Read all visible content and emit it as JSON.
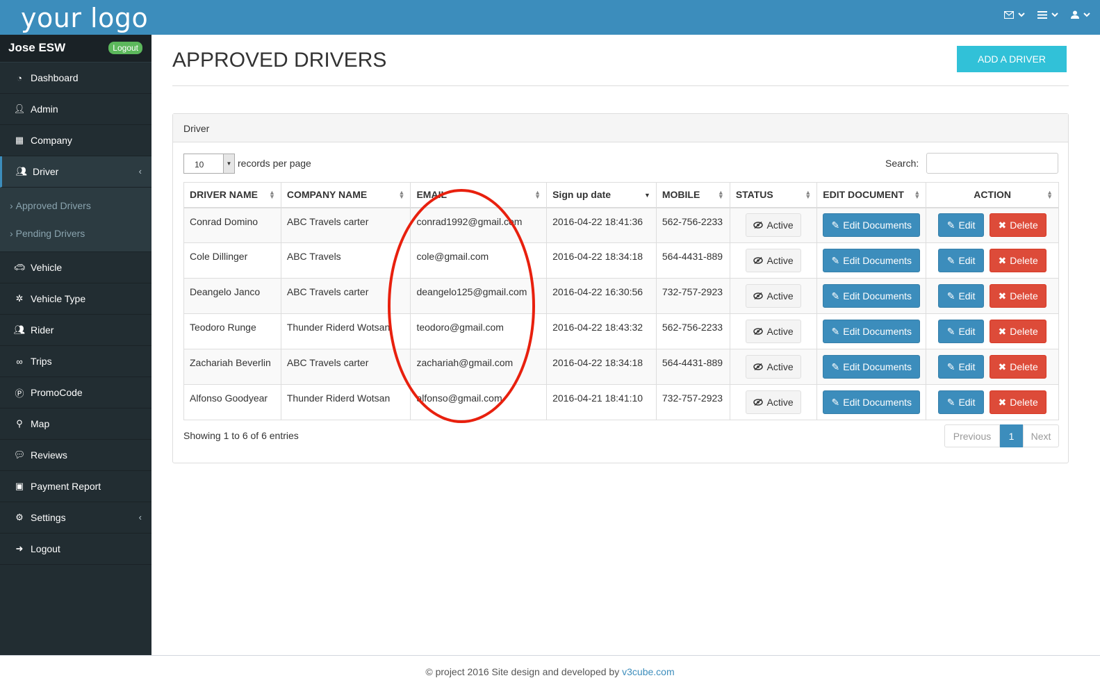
{
  "header": {
    "logo": "your logo",
    "icons": [
      "envelope-icon",
      "list-icon",
      "user-icon"
    ]
  },
  "sidebar": {
    "user_name": "Jose ESW",
    "logout_badge": "Logout",
    "items": [
      {
        "label": "Dashboard",
        "icon": "dashboard-icon"
      },
      {
        "label": "Admin",
        "icon": "user-icon"
      },
      {
        "label": "Company",
        "icon": "building-icon"
      },
      {
        "label": "Driver",
        "icon": "users-icon"
      },
      {
        "label": "Vehicle",
        "icon": "car-icon"
      },
      {
        "label": "Vehicle Type",
        "icon": "asterisk-icon"
      },
      {
        "label": "Rider",
        "icon": "users-icon"
      },
      {
        "label": "Trips",
        "icon": "trips-icon"
      },
      {
        "label": "PromoCode",
        "icon": "promo-icon"
      },
      {
        "label": "Map",
        "icon": "map-marker-icon"
      },
      {
        "label": "Reviews",
        "icon": "comments-icon"
      },
      {
        "label": "Payment Report",
        "icon": "money-icon"
      },
      {
        "label": "Settings",
        "icon": "cogs-icon"
      },
      {
        "label": "Logout",
        "icon": "sign-out-icon"
      }
    ],
    "driver_submenu": [
      "Approved Drivers",
      "Pending Drivers"
    ]
  },
  "page": {
    "title": "APPROVED DRIVERS",
    "add_button": "ADD A DRIVER",
    "panel_heading": "Driver",
    "length_value": "10",
    "length_label": "records per page",
    "search_label": "Search:",
    "info": "Showing 1 to 6 of 6 entries",
    "pager": {
      "prev": "Previous",
      "current": "1",
      "next": "Next"
    }
  },
  "table": {
    "columns": [
      "DRIVER NAME",
      "COMPANY NAME",
      "EMAIL",
      "Sign up date",
      "MOBILE",
      "STATUS",
      "EDIT DOCUMENT",
      "ACTION"
    ],
    "rows": [
      {
        "name": "Conrad Domino",
        "company": "ABC Travels carter",
        "email": "conrad1992@gmail.com",
        "date": "2016-04-22 18:41:36",
        "mobile": "562-756-2233",
        "status": "Active"
      },
      {
        "name": "Cole Dillinger",
        "company": "ABC Travels",
        "email": "cole@gmail.com",
        "date": "2016-04-22 18:34:18",
        "mobile": "564-4431-889",
        "status": "Active"
      },
      {
        "name": "Deangelo Janco",
        "company": "ABC Travels carter",
        "email": "deangelo125@gmail.com",
        "date": "2016-04-22 16:30:56",
        "mobile": "732-757-2923",
        "status": "Active"
      },
      {
        "name": "Teodoro Runge",
        "company": "Thunder Riderd Wotsan",
        "email": "teodoro@gmail.com",
        "date": "2016-04-22 18:43:32",
        "mobile": "562-756-2233",
        "status": "Active"
      },
      {
        "name": "Zachariah Beverlin",
        "company": "ABC Travels carter",
        "email": "zachariah@gmail.com",
        "date": "2016-04-22 18:34:18",
        "mobile": "564-4431-889",
        "status": "Active"
      },
      {
        "name": "Alfonso Goodyear",
        "company": "Thunder Riderd Wotsan",
        "email": "alfonso@gmail.com",
        "date": "2016-04-21 18:41:10",
        "mobile": "732-757-2923",
        "status": "Active"
      }
    ],
    "edit_documents_label": "Edit Documents",
    "edit_label": "Edit",
    "delete_label": "Delete"
  },
  "footer": {
    "text": "© project  2016   Site design and developed by",
    "link": "v3cube.com"
  },
  "colors": {
    "topbar": "#3c8dbc",
    "sidebar": "#222d32",
    "primary": "#3c8dbc",
    "danger": "#dd4b39",
    "info": "#31c1d8",
    "annotation": "#e8200e"
  }
}
